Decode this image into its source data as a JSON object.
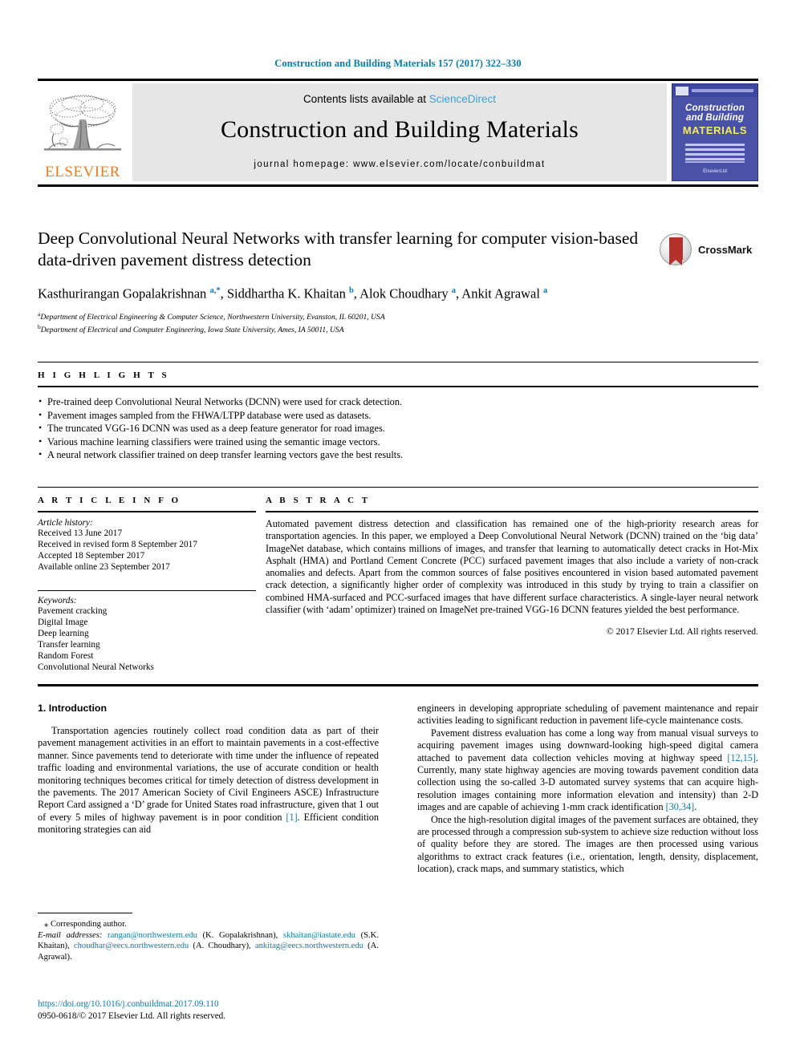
{
  "running_head": "Construction and Building Materials 157 (2017) 322–330",
  "masthead": {
    "contents_prefix": "Contents lists available at ",
    "sciencedirect": "ScienceDirect",
    "journal_title": "Construction and Building Materials",
    "homepage": "journal homepage: www.elsevier.com/locate/conbuildmat",
    "publisher_logo_text": "ELSEVIER",
    "cover": {
      "line1": "Construction",
      "line2": "and Building",
      "line3": "MATERIALS",
      "footer": "ElsevierLtd"
    }
  },
  "article": {
    "title": "Deep Convolutional Neural Networks with transfer learning for computer vision-based data-driven pavement distress detection",
    "authors_html": "Kasthurirangan Gopalakrishnan <sup>a,*</sup>, Siddhartha K. Khaitan <sup>b</sup>, Alok Choudhary <sup>a</sup>, Ankit Agrawal <sup>a</sup>",
    "affiliations": [
      {
        "marker": "a",
        "text": "Department of Electrical Engineering & Computer Science, Northwestern University, Evanston, IL 60201, USA"
      },
      {
        "marker": "b",
        "text": "Department of Electrical and Computer Engineering, Iowa State University, Ames, IA 50011, USA"
      }
    ],
    "crossmark_label": "CrossMark"
  },
  "highlights": {
    "label": "H I G H L I G H T S",
    "items": [
      "Pre-trained deep Convolutional Neural Networks (DCNN) were used for crack detection.",
      "Pavement images sampled from the FHWA/LTPP database were used as datasets.",
      "The truncated VGG-16 DCNN was used as a deep feature generator for road images.",
      "Various machine learning classifiers were trained using the semantic image vectors.",
      "A neural network classifier trained on deep transfer learning vectors gave the best results."
    ]
  },
  "article_info": {
    "label": "A R T I C L E   I N F O",
    "history_title": "Article history:",
    "history": [
      "Received 13 June 2017",
      "Received in revised form 8 September 2017",
      "Accepted 18 September 2017",
      "Available online 23 September 2017"
    ],
    "keywords_title": "Keywords:",
    "keywords": [
      "Pavement cracking",
      "Digital Image",
      "Deep learning",
      "Transfer learning",
      "Random Forest",
      "Convolutional Neural Networks"
    ]
  },
  "abstract": {
    "label": "A B S T R A C T",
    "text": "Automated pavement distress detection and classification has remained one of the high-priority research areas for transportation agencies. In this paper, we employed a Deep Convolutional Neural Network (DCNN) trained on the ‘big data’ ImageNet database, which contains millions of images, and transfer that learning to automatically detect cracks in Hot-Mix Asphalt (HMA) and Portland Cement Concrete (PCC) surfaced pavement images that also include a variety of non-crack anomalies and defects. Apart from the common sources of false positives encountered in vision based automated pavement crack detection, a significantly higher order of complexity was introduced in this study by trying to train a classifier on combined HMA-surfaced and PCC-surfaced images that have different surface characteristics. A single-layer neural network classifier (with ‘adam’ optimizer) trained on ImageNet pre-trained VGG-16 DCNN features yielded the best performance.",
    "copyright": "© 2017 Elsevier Ltd. All rights reserved."
  },
  "body": {
    "section_heading": "1. Introduction",
    "left_paragraphs": [
      "Transportation agencies routinely collect road condition data as part of their pavement management activities in an effort to maintain pavements in a cost-effective manner. Since pavements tend to deteriorate with time under the influence of repeated traffic loading and environmental variations, the use of accurate condition or health monitoring techniques becomes critical for timely detection of distress development in the pavements. The 2017 American Society of Civil Engineers ASCE) Infrastructure Report Card assigned a ‘D’ grade for United States road infrastructure, given that 1 out of every 5 miles of highway pavement is in poor condition [1]. Efficient condition monitoring strategies can aid"
    ],
    "left_paragraph_1_pre": "Transportation agencies routinely collect road condition data as part of their pavement management activities in an effort to maintain pavements in a cost-effective manner. Since pavements tend to deteriorate with time under the influence of repeated traffic loading and environmental variations, the use of accurate condition or health monitoring techniques becomes critical for timely detection of distress development in the pavements. The 2017 American Society of Civil Engineers ASCE) Infrastructure Report Card assigned a ‘D’ grade for United States road infrastructure, given that 1 out of every 5 miles of highway pavement is in poor condition ",
    "left_paragraph_1_ref": "[1]",
    "left_paragraph_1_post": ". Efficient condition monitoring strategies can aid",
    "right_p1": "engineers in developing appropriate scheduling of pavement maintenance and repair activities leading to significant reduction in pavement life-cycle maintenance costs.",
    "right_p2_pre": "Pavement distress evaluation has come a long way from manual visual surveys to acquiring pavement images using downward-looking high-speed digital camera attached to pavement data collection vehicles moving at highway speed ",
    "right_p2_ref1": "[12,15]",
    "right_p2_mid": ". Currently, many state highway agencies are moving towards pavement condition data collection using the so-called 3-D automated survey systems that can acquire high-resolution images containing more information elevation and intensity) than 2-D images and are capable of achieving 1-mm crack identification ",
    "right_p2_ref2": "[30,34]",
    "right_p2_post": ".",
    "right_p3": "Once the high-resolution digital images of the pavement surfaces are obtained, they are processed through a compression sub-system to achieve size reduction without loss of quality before they are stored. The images are then processed using various algorithms to extract crack features (i.e., orientation, length, density, displacement, location), crack maps, and summary statistics, which"
  },
  "footnote": {
    "corresponding": "⁎ Corresponding author.",
    "email_label": "E-mail addresses:",
    "emails": [
      {
        "address": "rangan@northwestern.edu",
        "name": "(K. Gopalakrishnan)"
      },
      {
        "address": "skhaitan@iastate.edu",
        "name": "(S.K. Khaitan)"
      },
      {
        "address": "choudhar@eecs.northwestern.edu",
        "name": "(A. Choudhary)"
      },
      {
        "address": "ankitag@eecs.northwestern.edu",
        "name": "(A. Agrawal)"
      }
    ],
    "doi": "https://doi.org/10.1016/j.conbuildmat.2017.09.110",
    "issn": "0950-0618/© 2017 Elsevier Ltd. All rights reserved."
  },
  "colors": {
    "link": "#0b7ab0",
    "elsevier_orange": "#f07c1b",
    "cover_blue": "#4a52a8",
    "crossmark_red": "#b3312a"
  }
}
